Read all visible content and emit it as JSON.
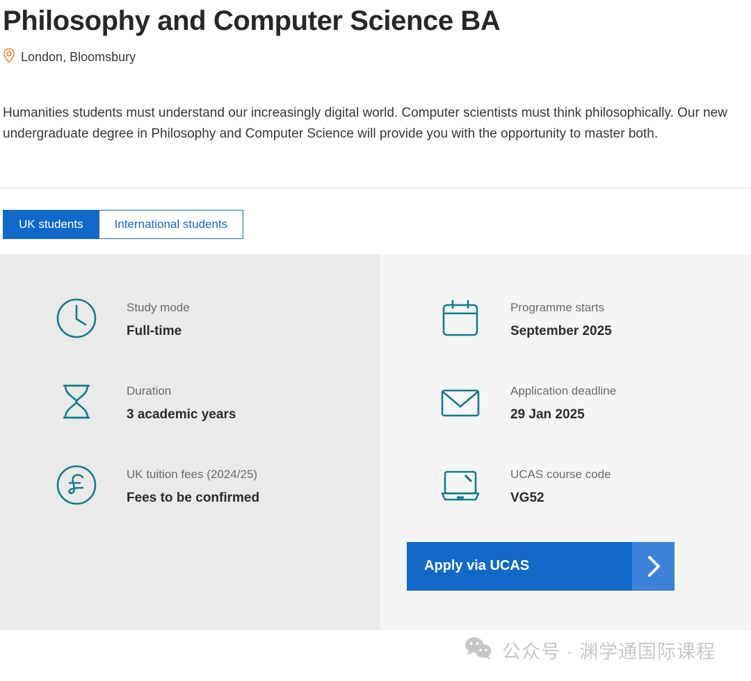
{
  "header": {
    "title": "Philosophy and Computer Science BA",
    "location": "London, Bloomsbury",
    "location_icon": "map-pin-icon"
  },
  "intro": {
    "paragraph": "Humanities students must understand our increasingly digital world. Computer scientists must think philosophically. Our new undergraduate degree in Philosophy and Computer Science will provide you with the opportunity to master both."
  },
  "tabs": [
    {
      "label": "UK students",
      "active": true
    },
    {
      "label": "International students",
      "active": false
    }
  ],
  "facts_left": [
    {
      "icon": "clock-icon",
      "label": "Study mode",
      "value": "Full-time"
    },
    {
      "icon": "hourglass-icon",
      "label": "Duration",
      "value": "3 academic years"
    },
    {
      "icon": "pound-icon",
      "label": "UK tuition fees (2024/25)",
      "value": "Fees to be confirmed"
    }
  ],
  "facts_right": [
    {
      "icon": "calendar-icon",
      "label": "Programme starts",
      "value": "September 2025"
    },
    {
      "icon": "envelope-icon",
      "label": "Application deadline",
      "value": "29 Jan 2025"
    },
    {
      "icon": "laptop-icon",
      "label": "UCAS course code",
      "value": "VG52"
    }
  ],
  "apply": {
    "label": "Apply via UCAS",
    "chevron_icon": "chevron-right-icon"
  },
  "watermark": {
    "icon": "wechat-icon",
    "text": "公众号 · 渊学通国际课程"
  },
  "colors": {
    "tab_active": "#1268c8",
    "tab_text": "#1268c8",
    "icon_teal": "#0f7d8c",
    "pin_orange": "#e8882a",
    "panel_left_bg": "#eaeaea",
    "panel_right_bg": "#f5f5f5",
    "apply_bg": "#1268c8",
    "apply_chevron_bg": "#3b82d8",
    "label_gray": "#6b6b6b",
    "value_dark": "#2b2b2b"
  }
}
